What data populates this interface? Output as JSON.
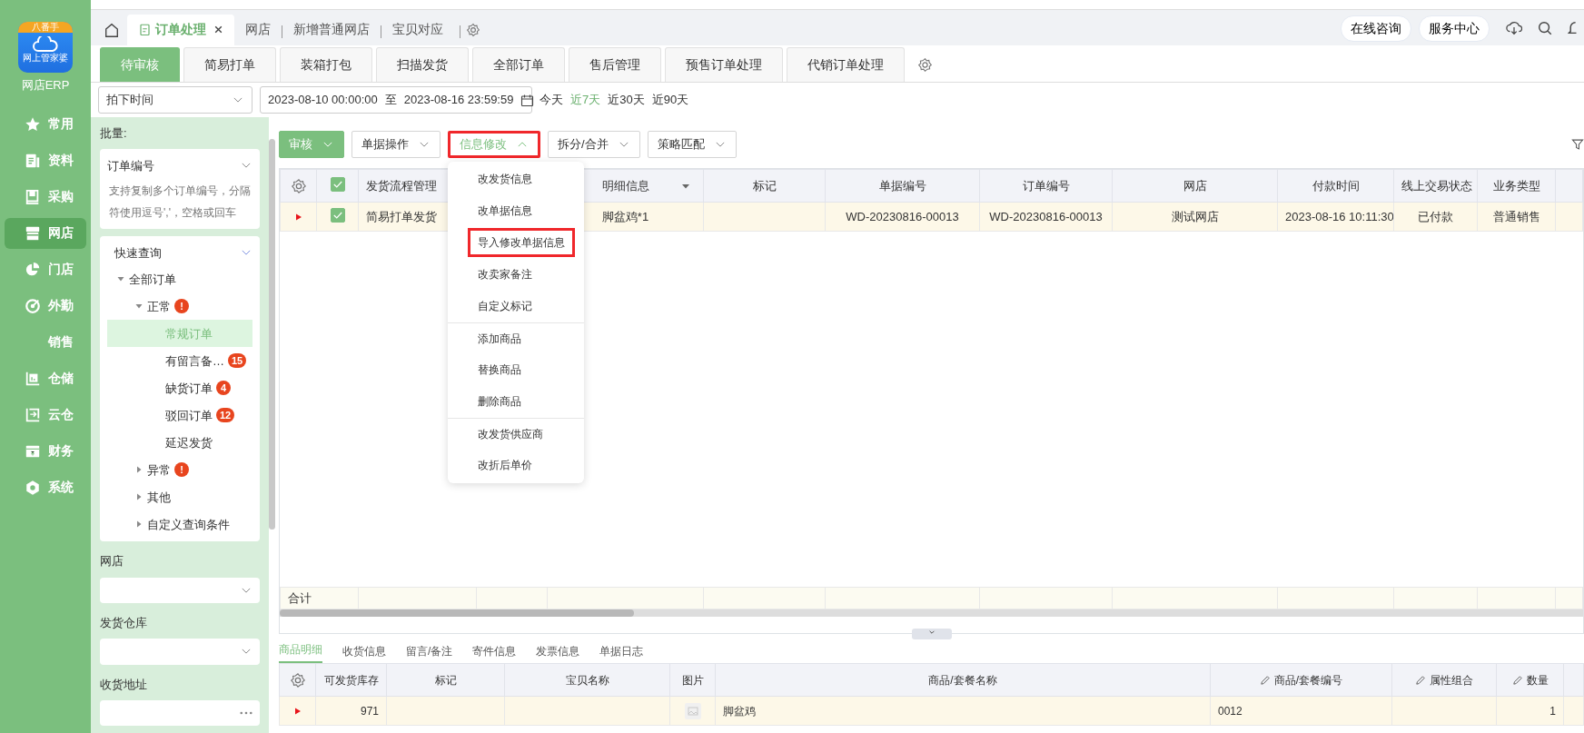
{
  "logo": {
    "badge": "八番手",
    "caption": "网上管家婆",
    "title": "网店ERP"
  },
  "nav": [
    {
      "label": "常用",
      "selected": false
    },
    {
      "label": "资料",
      "selected": false
    },
    {
      "label": "采购",
      "selected": false
    },
    {
      "label": "网店",
      "selected": true
    },
    {
      "label": "门店",
      "selected": false
    },
    {
      "label": "外勤",
      "selected": false
    },
    {
      "label": "销售",
      "selected": false
    },
    {
      "label": "仓储",
      "selected": false
    },
    {
      "label": "云仓",
      "selected": false
    },
    {
      "label": "财务",
      "selected": false
    },
    {
      "label": "系统",
      "selected": false
    }
  ],
  "top_tabs": [
    {
      "label": "订单处理",
      "selected": true,
      "closable": true
    },
    {
      "label": "网店",
      "selected": false,
      "closable": false
    },
    {
      "label": "新增普通网店",
      "selected": false,
      "closable": false
    },
    {
      "label": "宝贝对应",
      "selected": false,
      "closable": false
    }
  ],
  "header_buttons": [
    "在线咨询",
    "服务中心"
  ],
  "sub_tabs": [
    {
      "label": "待审核",
      "selected": true
    },
    {
      "label": "简易打单",
      "selected": false
    },
    {
      "label": "装箱打包",
      "selected": false
    },
    {
      "label": "扫描发货",
      "selected": false
    },
    {
      "label": "全部订单",
      "selected": false
    },
    {
      "label": "售后管理",
      "selected": false
    },
    {
      "label": "预售订单处理",
      "selected": false
    },
    {
      "label": "代销订单处理",
      "selected": false
    }
  ],
  "filter": {
    "time_field": "拍下时间",
    "start": "2023-08-10 00:00:00",
    "separator": "至",
    "end": "2023-08-16 23:59:59",
    "quick_ranges": [
      {
        "label": "今天",
        "selected": false
      },
      {
        "label": "近7天",
        "selected": true
      },
      {
        "label": "近30天",
        "selected": false
      },
      {
        "label": "近90天",
        "selected": false
      }
    ]
  },
  "side_panel": {
    "batch_label": "批量:",
    "batch_field": "订单编号",
    "batch_placeholder": "支持复制多个订单编号，分隔符使用逗号','，空格或回车",
    "quick_query": "快速查询",
    "tree": [
      {
        "label": "全部订单",
        "expanded": true,
        "selected": false,
        "children": [
          {
            "label": "正常",
            "expanded": true,
            "selected": false,
            "badge": "!",
            "children": [
              {
                "label": "常规订单",
                "selected": true
              },
              {
                "label": "有留言备…",
                "selected": false,
                "badge": "15"
              },
              {
                "label": "缺货订单",
                "selected": false,
                "badge": "4"
              },
              {
                "label": "驳回订单",
                "selected": false,
                "badge": "12"
              },
              {
                "label": "延迟发货",
                "selected": false
              }
            ]
          },
          {
            "label": "异常",
            "expanded": false,
            "selected": false,
            "badge": "!"
          },
          {
            "label": "其他",
            "expanded": false,
            "selected": false
          },
          {
            "label": "自定义查询条件",
            "expanded": false,
            "selected": false
          }
        ]
      }
    ],
    "filters": [
      {
        "label": "网店",
        "kind": "select"
      },
      {
        "label": "发货仓库",
        "kind": "select"
      },
      {
        "label": "收货地址",
        "kind": "more"
      }
    ]
  },
  "toolbar": [
    {
      "label": "审核",
      "kind": "primary",
      "open": false,
      "highlighted": false
    },
    {
      "label": "单据操作",
      "kind": "plain",
      "open": false,
      "highlighted": false
    },
    {
      "label": "信息修改",
      "kind": "plain",
      "open": true,
      "highlighted": true
    },
    {
      "label": "拆分/合并",
      "kind": "plain",
      "open": false,
      "highlighted": false
    },
    {
      "label": "策略匹配",
      "kind": "plain",
      "open": false,
      "highlighted": false
    }
  ],
  "menu": {
    "groups": [
      [
        {
          "label": "改发货信息",
          "highlighted": false
        },
        {
          "label": "改单据信息",
          "highlighted": false
        },
        {
          "label": "导入修改单据信息",
          "highlighted": true
        },
        {
          "label": "改卖家备注",
          "highlighted": false
        },
        {
          "label": "自定义标记",
          "highlighted": false
        }
      ],
      [
        {
          "label": "添加商品",
          "highlighted": false
        },
        {
          "label": "替换商品",
          "highlighted": false
        },
        {
          "label": "删除商品",
          "highlighted": false
        }
      ],
      [
        {
          "label": "改发货供应商",
          "highlighted": false
        },
        {
          "label": "改折后单价",
          "highlighted": false
        }
      ]
    ]
  },
  "orders": {
    "all_checked": true,
    "columns": [
      {
        "label": "发货流程管理",
        "kind": "plain"
      },
      {
        "kind": "plain"
      },
      {
        "label": "明细信息",
        "kind": "dropdown"
      },
      {
        "label": "标记",
        "kind": "plain"
      },
      {
        "label": "单据编号",
        "kind": "plain"
      },
      {
        "label": "订单编号",
        "kind": "plain"
      },
      {
        "label": "网店",
        "kind": "plain"
      },
      {
        "label": "付款时间",
        "kind": "plain"
      },
      {
        "label": "线上交易状态",
        "kind": "plain"
      },
      {
        "label": "业务类型",
        "kind": "plain"
      }
    ],
    "rows": [
      {
        "current": true,
        "checked": true,
        "cells": [
          "简易打单发货",
          null,
          "脚盆鸡*1",
          null,
          "WD-20230816-00013",
          "WD-20230816-00013",
          "测试网店",
          "2023-08-16 10:11:30",
          "已付款",
          "普通销售"
        ]
      }
    ],
    "total_label": "合计"
  },
  "detail_tabs": [
    {
      "label": "商品明细",
      "selected": true
    },
    {
      "label": "收货信息",
      "selected": false
    },
    {
      "label": "留言/备注",
      "selected": false
    },
    {
      "label": "寄件信息",
      "selected": false
    },
    {
      "label": "发票信息",
      "selected": false
    },
    {
      "label": "单据日志",
      "selected": false
    }
  ],
  "items": {
    "columns": [
      {
        "label": "可发货库存",
        "editable": false
      },
      {
        "label": "标记",
        "editable": false
      },
      {
        "label": "宝贝名称",
        "editable": false
      },
      {
        "label": "图片",
        "editable": false
      },
      {
        "label": "商品/套餐名称",
        "editable": false
      },
      {
        "label": "商品/套餐编号",
        "editable": true
      },
      {
        "label": "属性组合",
        "editable": true
      },
      {
        "label": "数量",
        "editable": true
      }
    ],
    "rows": [
      {
        "current": true,
        "cells": [
          {
            "kind": "number",
            "text": "971"
          },
          {
            "kind": "text"
          },
          {
            "kind": "text"
          },
          {
            "kind": "picture"
          },
          {
            "kind": "text",
            "text": "脚盆鸡"
          },
          {
            "kind": "text",
            "text": "0012"
          },
          {
            "kind": "text"
          },
          {
            "kind": "number",
            "text": "1"
          }
        ]
      }
    ]
  }
}
